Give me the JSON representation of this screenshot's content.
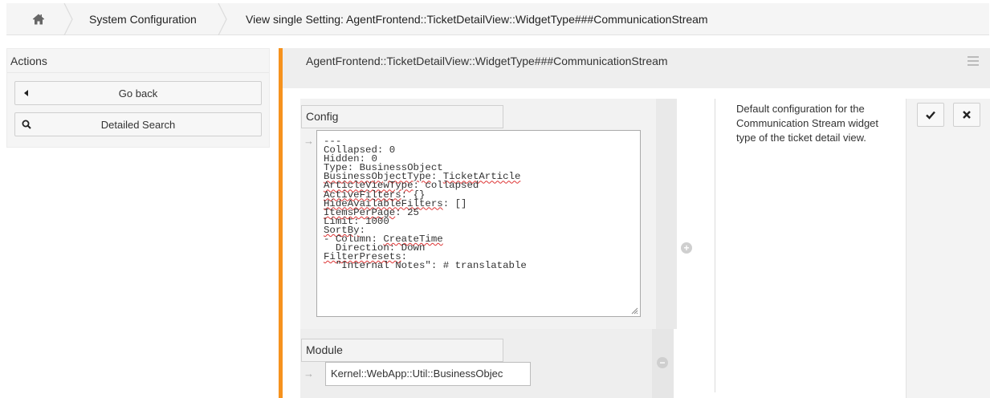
{
  "breadcrumb": {
    "home_icon": "home-icon",
    "item1": "System Configuration",
    "item2": "View single Setting: AgentFrontend::TicketDetailView::WidgetType###CommunicationStream"
  },
  "sidebar": {
    "title": "Actions",
    "buttons": [
      {
        "label": "Go back",
        "icon": "caret-left-icon"
      },
      {
        "label": "Detailed Search",
        "icon": "search-icon"
      }
    ]
  },
  "setting": {
    "title": "AgentFrontend::TicketDetailView::WidgetType###CommunicationStream",
    "config_label": "Config",
    "config_lines": [
      {
        "text": "---",
        "squiggle": ""
      },
      {
        "text": "Collapsed: 0",
        "squiggle": ""
      },
      {
        "text": "Hidden: 0",
        "squiggle": ""
      },
      {
        "text": "Type: BusinessObject",
        "squiggle": ""
      },
      {
        "text": "BusinessObjectType: TicketArticle",
        "squiggle": ""
      },
      {
        "text": "ArticleViewType: collapsed",
        "squiggle": ""
      },
      {
        "text": "ActiveFilters: {}",
        "squiggle": ""
      },
      {
        "text": "HideAvailableFilters: []",
        "squiggle": ""
      },
      {
        "text": "ItemsPerPage: 25",
        "squiggle": ""
      },
      {
        "text": "Limit: 1000",
        "squiggle": ""
      },
      {
        "text": "SortBy:",
        "squiggle": ""
      },
      {
        "text": "- Column: CreateTime",
        "squiggle": ""
      },
      {
        "text": "  Direction: Down",
        "squiggle": ""
      },
      {
        "text": "FilterPresets:",
        "squiggle": ""
      },
      {
        "text": "  \"Internal Notes\": # translatable",
        "squiggle": ""
      }
    ],
    "module_label": "Module",
    "module_value": "Kernel::WebApp::Util::BusinessObjec",
    "description": "Default configuration for the Communication Stream widget type of the ticket detail view.",
    "accent_color": "#f6921e"
  }
}
